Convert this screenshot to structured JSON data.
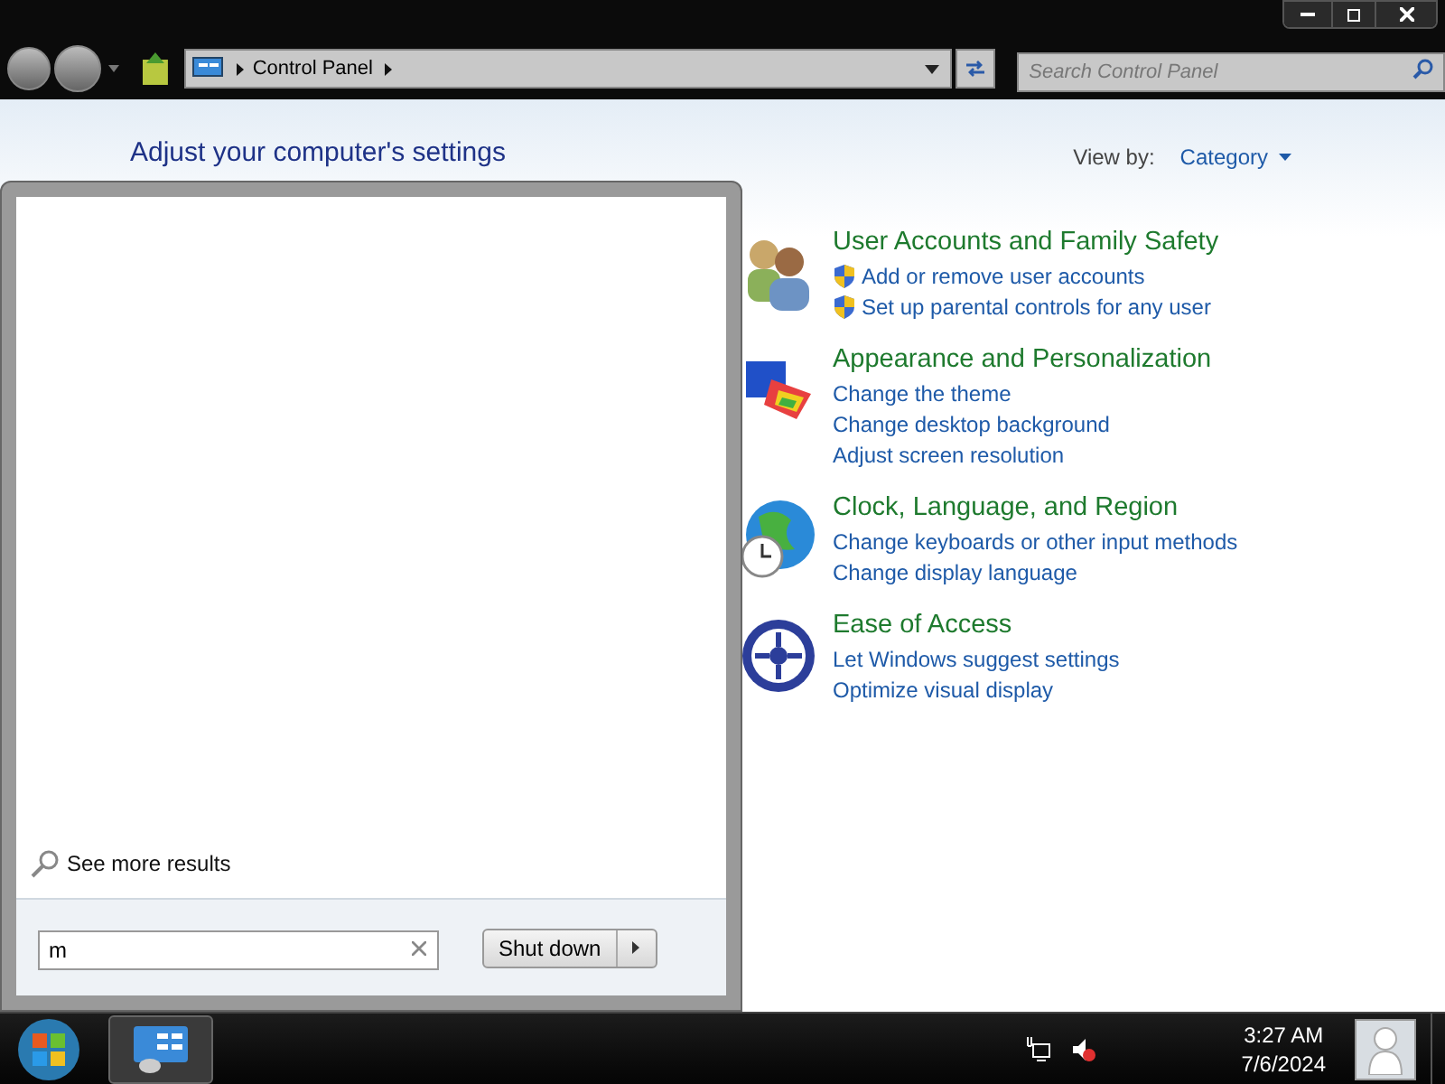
{
  "address_bar": {
    "breadcrumb": "Control Panel"
  },
  "search": {
    "placeholder": "Search Control Panel"
  },
  "heading": "Adjust your computer's settings",
  "view_by": {
    "label": "View by:",
    "value": "Category"
  },
  "categories": [
    {
      "kind": "users",
      "title": "User Accounts and Family Safety",
      "links": [
        {
          "text": "Add or remove user accounts",
          "shield": true
        },
        {
          "text": "Set up parental controls for any user",
          "shield": true
        }
      ]
    },
    {
      "kind": "appearance",
      "title": "Appearance and Personalization",
      "links": [
        {
          "text": "Change the theme",
          "shield": false
        },
        {
          "text": "Change desktop background",
          "shield": false
        },
        {
          "text": "Adjust screen resolution",
          "shield": false
        }
      ]
    },
    {
      "kind": "clock",
      "title": "Clock, Language, and Region",
      "links": [
        {
          "text": "Change keyboards or other input methods",
          "shield": false
        },
        {
          "text": "Change display language",
          "shield": false
        }
      ]
    },
    {
      "kind": "access",
      "title": "Ease of Access",
      "links": [
        {
          "text": "Let Windows suggest settings",
          "shield": false
        },
        {
          "text": "Optimize visual display",
          "shield": false
        }
      ]
    }
  ],
  "start_menu": {
    "see_more": "See more results",
    "search_value": "m",
    "shutdown": "Shut down"
  },
  "taskbar": {
    "time": "3:27 AM",
    "date": "7/6/2024"
  }
}
